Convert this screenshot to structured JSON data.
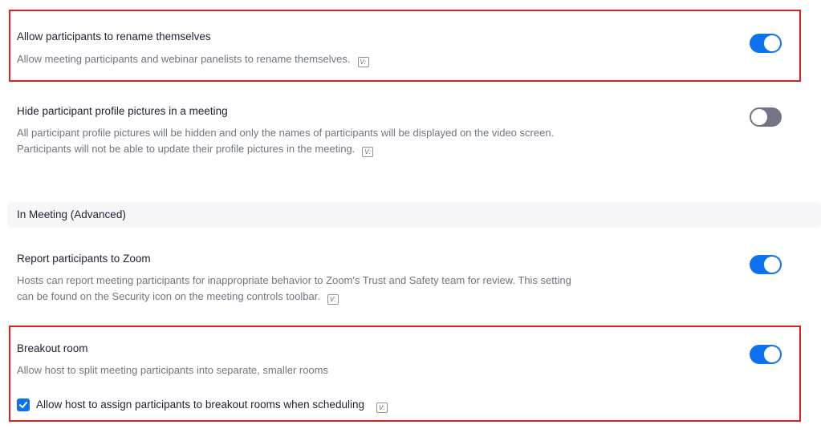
{
  "colors": {
    "toggle_on": "#0e72ed",
    "toggle_off": "#747487",
    "highlight_border": "#e02020"
  },
  "settings": [
    {
      "title": "Allow participants to rename themselves",
      "description": "Allow meeting participants and webinar panelists to rename themselves.",
      "enabled": true,
      "icon": "version-info-icon"
    },
    {
      "title": "Hide participant profile pictures in a meeting",
      "description": "All participant profile pictures will be hidden and only the names of participants will be displayed on the video screen. Participants will not be able to update their profile pictures in the meeting.",
      "enabled": false,
      "icon": "version-info-icon"
    }
  ],
  "section": {
    "title": "In Meeting (Advanced)"
  },
  "advanced_settings": [
    {
      "title": "Report participants to Zoom",
      "description": "Hosts can report meeting participants for inappropriate behavior to Zoom's Trust and Safety team for review. This setting can be found on the Security icon on the meeting controls toolbar.",
      "enabled": true,
      "icon": "version-info-icon"
    },
    {
      "title": "Breakout room",
      "description": "Allow host to split meeting participants into separate, smaller rooms",
      "enabled": true,
      "sub_option": {
        "label": "Allow host to assign participants to breakout rooms when scheduling",
        "checked": true,
        "icon": "version-info-icon"
      }
    }
  ],
  "version_icon_glyph": "V:"
}
